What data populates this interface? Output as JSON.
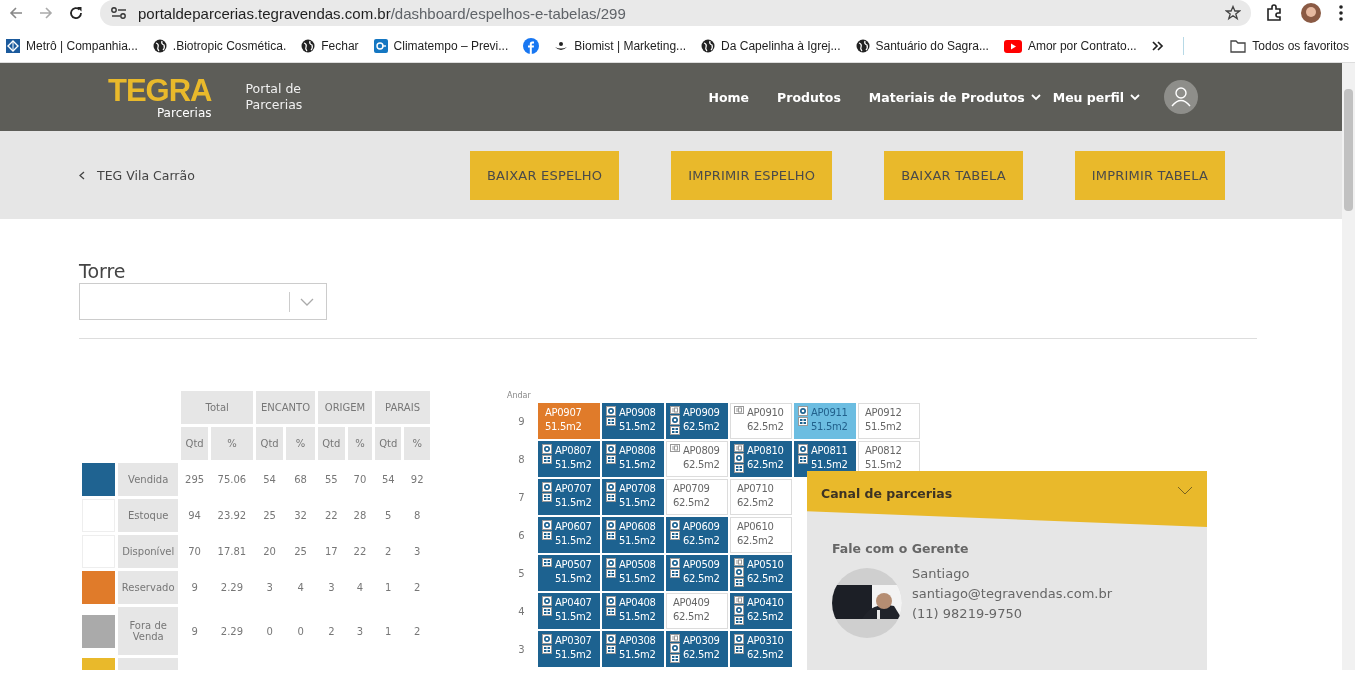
{
  "browser": {
    "url_host": "portaldeparcerias.tegravendas.com.br",
    "url_path": "/dashboard/espelhos-e-tabelas/299",
    "bookmarks": [
      {
        "label": "Metrô | Companhia...",
        "kind": "metro"
      },
      {
        "label": ".Biotropic Cosmética.",
        "kind": "globe"
      },
      {
        "label": "Fechar",
        "kind": "globe"
      },
      {
        "label": "Climatempo – Previ...",
        "kind": "climatempo"
      },
      {
        "kind": "facebook"
      },
      {
        "label": "Biomist | Marketing...",
        "kind": "biomist"
      },
      {
        "label": "Da Capelinha à Igrej...",
        "kind": "globe"
      },
      {
        "label": "Santuário do Sagra...",
        "kind": "globe"
      },
      {
        "label": "Amor por Contrato...",
        "kind": "youtube"
      }
    ],
    "all_bookmarks": "Todos os favoritos"
  },
  "header": {
    "brand": "TEGRA",
    "brand_sub": "Parcerias",
    "portal_title": "Portal de Parcerias",
    "nav": [
      {
        "label": "Home",
        "dropdown": false
      },
      {
        "label": "Produtos",
        "dropdown": false
      },
      {
        "label": "Materiais de Produtos",
        "dropdown": true
      },
      {
        "label": "Meu perfil",
        "dropdown": true
      }
    ]
  },
  "action_bar": {
    "back_link": "TEG Vila Carrão",
    "buttons": [
      "BAIXAR ESPELHO",
      "IMPRIMIR ESPELHO",
      "BAIXAR TABELA",
      "IMPRIMIR TABELA"
    ]
  },
  "torre": {
    "label": "Torre"
  },
  "stats": {
    "groups": [
      "Total",
      "ENCANTO",
      "ORIGEM",
      "PARAIS"
    ],
    "subheaders": [
      "Qtd",
      "%",
      "Qtd",
      "%",
      "Qtd",
      "%",
      "Qtd",
      "%"
    ],
    "rows": [
      {
        "label": "Vendida",
        "color": "#1f6391",
        "values": [
          "295",
          "75.06",
          "54",
          "68",
          "55",
          "70",
          "54",
          "92"
        ]
      },
      {
        "label": "Estoque",
        "color": "#ffffff",
        "values": [
          "94",
          "23.92",
          "25",
          "32",
          "22",
          "28",
          "5",
          "8"
        ]
      },
      {
        "label": "Disponível",
        "color": "#ffffff",
        "values": [
          "70",
          "17.81",
          "20",
          "25",
          "17",
          "22",
          "2",
          "3"
        ]
      },
      {
        "label": "Reservado",
        "color": "#e07b2a",
        "values": [
          "9",
          "2.29",
          "3",
          "4",
          "3",
          "4",
          "1",
          "2"
        ]
      },
      {
        "label": "Fora de Venda",
        "color": "#aaaaaa",
        "values": [
          "9",
          "2.29",
          "0",
          "0",
          "2",
          "3",
          "1",
          "2"
        ]
      },
      {
        "color": "#e9b92b"
      }
    ]
  },
  "units": {
    "floor_label": "Andar",
    "floors": [
      {
        "floor": "9",
        "units": [
          {
            "code": "AP0907",
            "area": "51.5m2",
            "kind": "reserved",
            "id_badge": false,
            "money_badge": false,
            "calc_badge": false
          },
          {
            "code": "AP0908",
            "area": "51.5m2",
            "kind": "sold",
            "id_badge": false,
            "money_badge": true,
            "calc_badge": true
          },
          {
            "code": "AP0909",
            "area": "62.5m2",
            "kind": "sold",
            "id_badge": true,
            "money_badge": true,
            "calc_badge": true
          },
          {
            "code": "AP0910",
            "area": "62.5m2",
            "kind": "available",
            "id_badge": true,
            "money_badge": false,
            "calc_badge": false
          },
          {
            "code": "AP0911",
            "area": "51.5m2",
            "kind": "highlight",
            "id_badge": false,
            "money_badge": true,
            "calc_badge": true
          },
          {
            "code": "AP0912",
            "area": "51.5m2",
            "kind": "available",
            "id_badge": false,
            "money_badge": false,
            "calc_badge": false
          }
        ]
      },
      {
        "floor": "8",
        "units": [
          {
            "code": "AP0807",
            "area": "51.5m2",
            "kind": "sold",
            "id_badge": false,
            "money_badge": true,
            "calc_badge": true
          },
          {
            "code": "AP0808",
            "area": "51.5m2",
            "kind": "sold",
            "id_badge": false,
            "money_badge": true,
            "calc_badge": true
          },
          {
            "code": "AP0809",
            "area": "62.5m2",
            "kind": "available",
            "id_badge": true,
            "money_badge": false,
            "calc_badge": false
          },
          {
            "code": "AP0810",
            "area": "62.5m2",
            "kind": "sold",
            "id_badge": true,
            "money_badge": true,
            "calc_badge": true
          },
          {
            "code": "AP0811",
            "area": "51.5m2",
            "kind": "sold",
            "id_badge": false,
            "money_badge": true,
            "calc_badge": true
          },
          {
            "code": "AP0812",
            "area": "51.5m2",
            "kind": "available",
            "id_badge": false,
            "money_badge": false,
            "calc_badge": false
          }
        ]
      },
      {
        "floor": "7",
        "units": [
          {
            "code": "AP0707",
            "area": "51.5m2",
            "kind": "sold",
            "id_badge": false,
            "money_badge": true,
            "calc_badge": true
          },
          {
            "code": "AP0708",
            "area": "51.5m2",
            "kind": "sold",
            "id_badge": false,
            "money_badge": true,
            "calc_badge": true
          },
          {
            "code": "AP0709",
            "area": "62.5m2",
            "kind": "available",
            "id_badge": false,
            "money_badge": false,
            "calc_badge": false
          },
          {
            "code": "AP0710",
            "area": "62.5m2",
            "kind": "available",
            "id_badge": false,
            "money_badge": false,
            "calc_badge": false
          }
        ]
      },
      {
        "floor": "6",
        "units": [
          {
            "code": "AP0607",
            "area": "51.5m2",
            "kind": "sold",
            "id_badge": false,
            "money_badge": true,
            "calc_badge": true
          },
          {
            "code": "AP0608",
            "area": "51.5m2",
            "kind": "sold",
            "id_badge": false,
            "money_badge": true,
            "calc_badge": true
          },
          {
            "code": "AP0609",
            "area": "62.5m2",
            "kind": "sold",
            "id_badge": false,
            "money_badge": true,
            "calc_badge": true
          },
          {
            "code": "AP0610",
            "area": "62.5m2",
            "kind": "available",
            "id_badge": false,
            "money_badge": false,
            "calc_badge": false
          }
        ]
      },
      {
        "floor": "5",
        "units": [
          {
            "code": "AP0507",
            "area": "51.5m2",
            "kind": "sold",
            "id_badge": false,
            "money_badge": false,
            "calc_badge": true
          },
          {
            "code": "AP0508",
            "area": "51.5m2",
            "kind": "sold",
            "id_badge": false,
            "money_badge": true,
            "calc_badge": true
          },
          {
            "code": "AP0509",
            "area": "62.5m2",
            "kind": "sold",
            "id_badge": false,
            "money_badge": true,
            "calc_badge": true
          },
          {
            "code": "AP0510",
            "area": "62.5m2",
            "kind": "sold",
            "id_badge": true,
            "money_badge": true,
            "calc_badge": true
          }
        ]
      },
      {
        "floor": "4",
        "units": [
          {
            "code": "AP0407",
            "area": "51.5m2",
            "kind": "sold",
            "id_badge": false,
            "money_badge": true,
            "calc_badge": true
          },
          {
            "code": "AP0408",
            "area": "51.5m2",
            "kind": "sold",
            "id_badge": false,
            "money_badge": true,
            "calc_badge": true
          },
          {
            "code": "AP0409",
            "area": "62.5m2",
            "kind": "available",
            "id_badge": false,
            "money_badge": false,
            "calc_badge": false
          },
          {
            "code": "AP0410",
            "area": "62.5m2",
            "kind": "sold",
            "id_badge": true,
            "money_badge": true,
            "calc_badge": true
          }
        ]
      },
      {
        "floor": "3",
        "units": [
          {
            "code": "AP0307",
            "area": "51.5m2",
            "kind": "sold",
            "id_badge": false,
            "money_badge": true,
            "calc_badge": true
          },
          {
            "code": "AP0308",
            "area": "51.5m2",
            "kind": "sold",
            "id_badge": false,
            "money_badge": true,
            "calc_badge": true
          },
          {
            "code": "AP0309",
            "area": "62.5m2",
            "kind": "sold",
            "id_badge": true,
            "money_badge": true,
            "calc_badge": true
          },
          {
            "code": "AP0310",
            "area": "62.5m2",
            "kind": "sold",
            "id_badge": false,
            "money_badge": true,
            "calc_badge": true
          }
        ]
      }
    ]
  },
  "chat_panel": {
    "title": "Canal de parcerias",
    "expanded": true,
    "subtitle": "Fale com o Gerente",
    "name": "Santiago",
    "email": "santiago@tegravendas.com.br",
    "phone": "(11) 98219-9750"
  }
}
